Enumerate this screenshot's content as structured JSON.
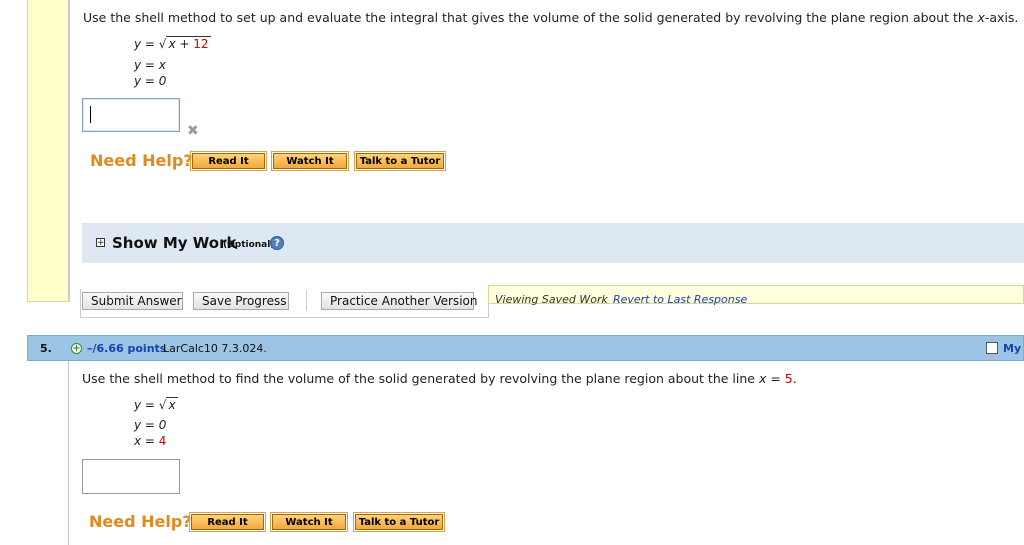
{
  "q4": {
    "prompt_a": "Use the shell method to set up and evaluate the integral that gives the volume of the solid generated by revolving the plane region about the ",
    "prompt_var": "x",
    "prompt_b": "-axis.",
    "eq1_lhs": "y",
    "eq1_eq": " = ",
    "eq1_rad": "x + ",
    "eq1_num": "12",
    "eq2": "y = x",
    "eq3": "y = 0",
    "answer_value": "",
    "clear_glyph": "✖",
    "need_help": "Need Help?",
    "read_it": "Read It",
    "watch_it": "Watch It",
    "talk_tutor": "Talk to a Tutor",
    "show_work": "Show My Work",
    "optional": "(Optional)",
    "submit": "Submit Answer",
    "save": "Save Progress",
    "practice": "Practice Another Version",
    "viewing": "Viewing Saved Work",
    "revert": "Revert to Last Response"
  },
  "q5": {
    "number": "5.",
    "points": "–/6.66 points",
    "ref": "LarCalc10 7.3.024.",
    "my_label": "My I",
    "prompt": "Use the shell method to find the volume of the solid generated by revolving the plane region about the line ",
    "prompt_var": "x",
    "prompt_eq": " = ",
    "prompt_num": "5",
    "prompt_end": ".",
    "eq1_lhs": "y",
    "eq1_eq": " = ",
    "eq1_rad": "x",
    "eq2": "y = 0",
    "eq3_lhs": "x = ",
    "eq3_num": "4",
    "need_help": "Need Help?",
    "read_it": "Read It",
    "watch_it": "Watch It",
    "talk_tutor": "Talk to a Tutor"
  },
  "colors": {
    "need_help": "#e08a1e",
    "header_blue": "#9cc4e4",
    "show_work_bg": "#dde8f2",
    "math_red": "#cc0000"
  },
  "icons": {
    "clear": "close-x-icon",
    "expand": "plus-box-icon",
    "help": "question-circle-icon",
    "add": "plus-circle-icon",
    "my_notes": "checkbox-icon"
  }
}
